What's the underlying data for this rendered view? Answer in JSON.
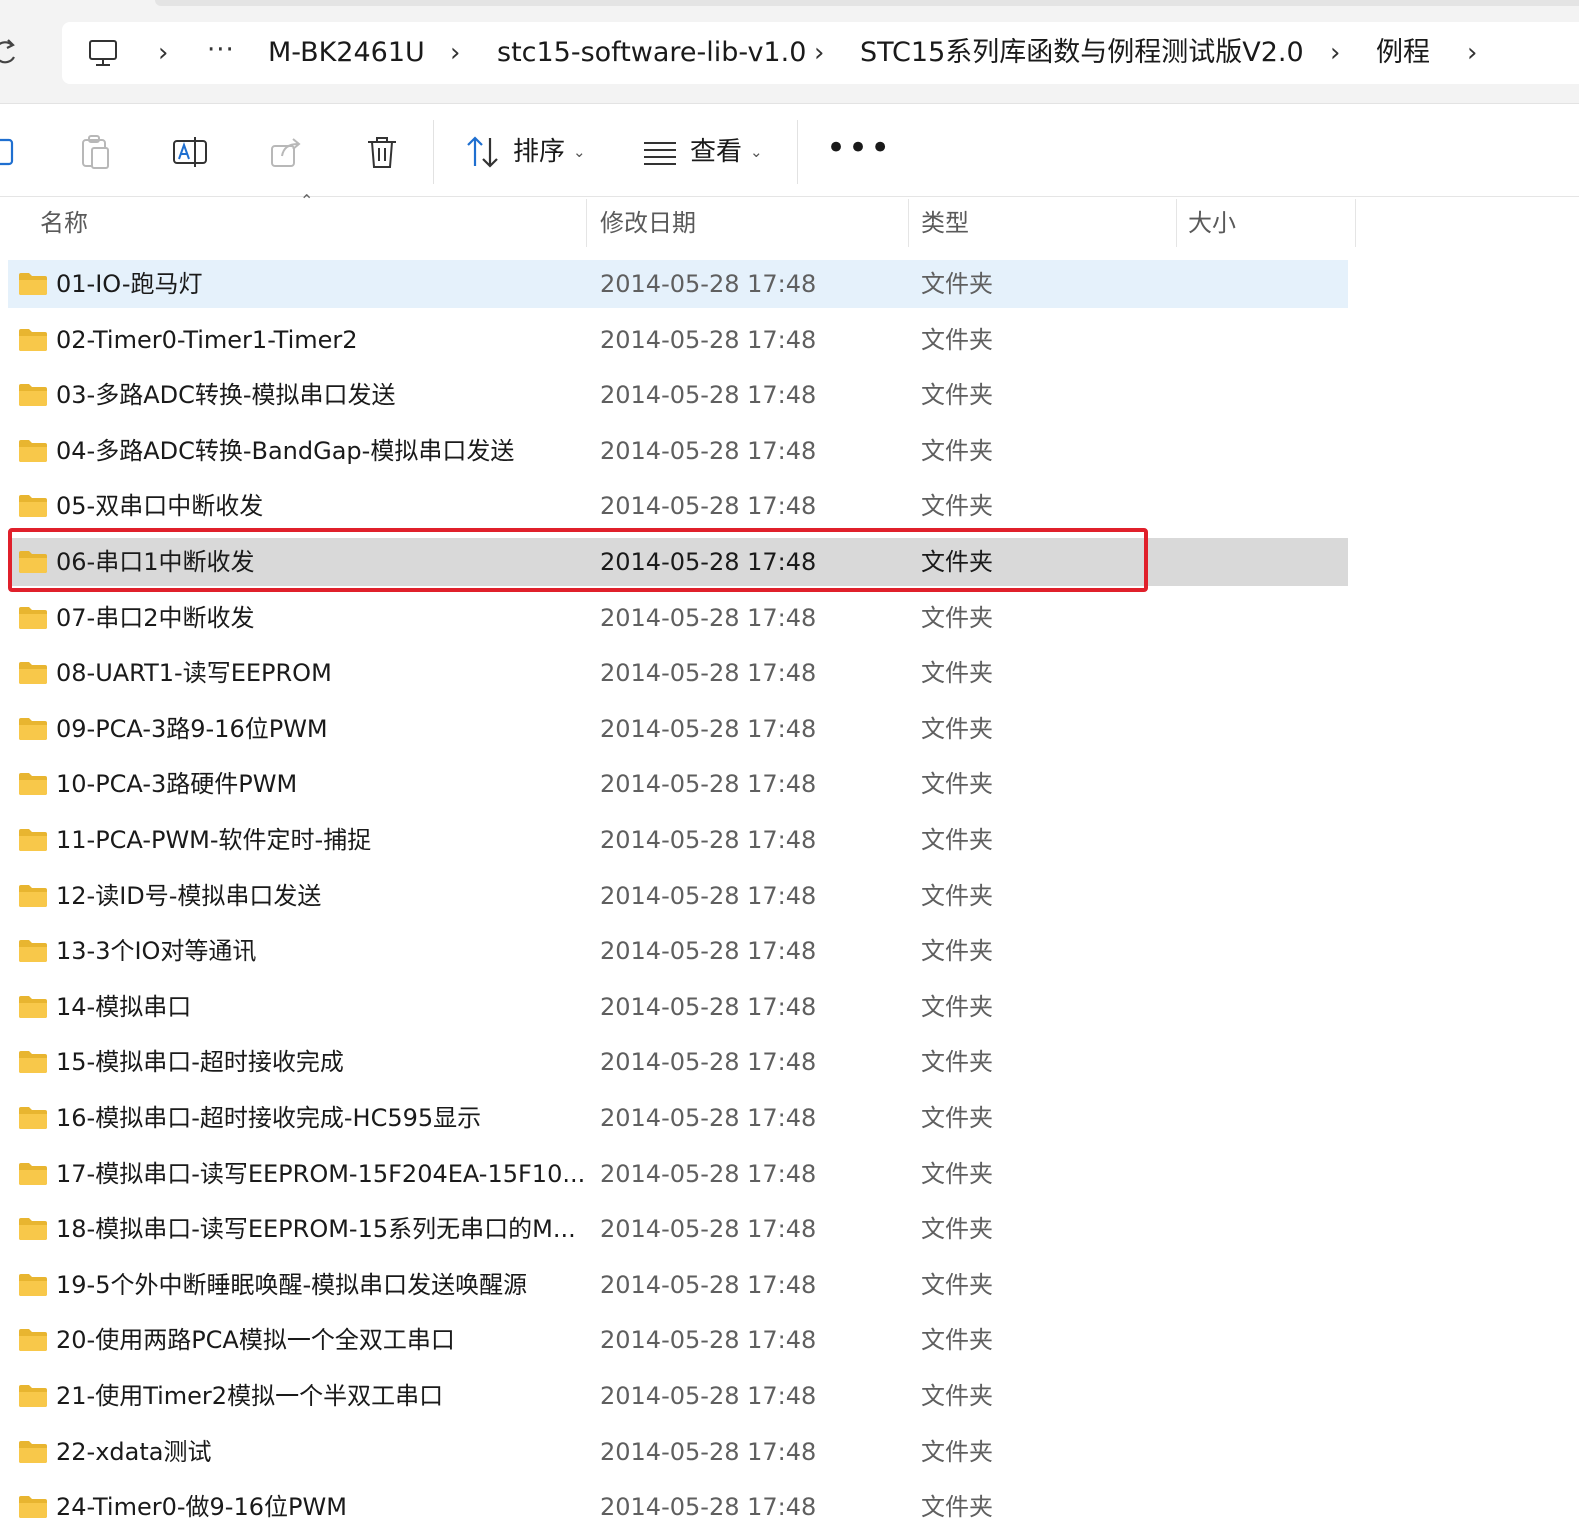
{
  "address_bar": {
    "breadcrumbs": [
      "M-BK2461U",
      "stc15-software-lib-v1.0",
      "STC15系列库函数与例程测试版V2.0",
      "例程"
    ],
    "overflow": "···"
  },
  "toolbar": {
    "sort_label": "排序",
    "view_label": "查看",
    "more_label": "•••"
  },
  "columns": {
    "name": "名称",
    "modified": "修改日期",
    "type": "类型",
    "size": "大小"
  },
  "files": [
    {
      "name": "01-IO-跑马灯",
      "modified": "2014-05-28 17:48",
      "type": "文件夹"
    },
    {
      "name": "02-Timer0-Timer1-Timer2",
      "modified": "2014-05-28 17:48",
      "type": "文件夹"
    },
    {
      "name": "03-多路ADC转换-模拟串口发送",
      "modified": "2014-05-28 17:48",
      "type": "文件夹"
    },
    {
      "name": "04-多路ADC转换-BandGap-模拟串口发送",
      "modified": "2014-05-28 17:48",
      "type": "文件夹"
    },
    {
      "name": "05-双串口中断收发",
      "modified": "2014-05-28 17:48",
      "type": "文件夹"
    },
    {
      "name": "06-串口1中断收发",
      "modified": "2014-05-28 17:48",
      "type": "文件夹"
    },
    {
      "name": "07-串口2中断收发",
      "modified": "2014-05-28 17:48",
      "type": "文件夹"
    },
    {
      "name": "08-UART1-读写EEPROM",
      "modified": "2014-05-28 17:48",
      "type": "文件夹"
    },
    {
      "name": "09-PCA-3路9-16位PWM",
      "modified": "2014-05-28 17:48",
      "type": "文件夹"
    },
    {
      "name": "10-PCA-3路硬件PWM",
      "modified": "2014-05-28 17:48",
      "type": "文件夹"
    },
    {
      "name": "11-PCA-PWM-软件定时-捕捉",
      "modified": "2014-05-28 17:48",
      "type": "文件夹"
    },
    {
      "name": "12-读ID号-模拟串口发送",
      "modified": "2014-05-28 17:48",
      "type": "文件夹"
    },
    {
      "name": "13-3个IO对等通讯",
      "modified": "2014-05-28 17:48",
      "type": "文件夹"
    },
    {
      "name": "14-模拟串口",
      "modified": "2014-05-28 17:48",
      "type": "文件夹"
    },
    {
      "name": "15-模拟串口-超时接收完成",
      "modified": "2014-05-28 17:48",
      "type": "文件夹"
    },
    {
      "name": "16-模拟串口-超时接收完成-HC595显示",
      "modified": "2014-05-28 17:48",
      "type": "文件夹"
    },
    {
      "name": "17-模拟串口-读写EEPROM-15F204EA-15F10...",
      "modified": "2014-05-28 17:48",
      "type": "文件夹"
    },
    {
      "name": "18-模拟串口-读写EEPROM-15系列无串口的M...",
      "modified": "2014-05-28 17:48",
      "type": "文件夹"
    },
    {
      "name": "19-5个外中断睡眠唤醒-模拟串口发送唤醒源",
      "modified": "2014-05-28 17:48",
      "type": "文件夹"
    },
    {
      "name": "20-使用两路PCA模拟一个全双工串口",
      "modified": "2014-05-28 17:48",
      "type": "文件夹"
    },
    {
      "name": "21-使用Timer2模拟一个半双工串口",
      "modified": "2014-05-28 17:48",
      "type": "文件夹"
    },
    {
      "name": "22-xdata测试",
      "modified": "2014-05-28 17:48",
      "type": "文件夹"
    },
    {
      "name": "24-Timer0-做9-16位PWM",
      "modified": "2014-05-28 17:48",
      "type": "文件夹"
    }
  ],
  "hover_index": 0,
  "selected_index": 5,
  "colors": {
    "hover": "#e5f1fb",
    "selected": "#d9d9d9",
    "highlight_box": "#e0202b",
    "folder": "#f8c84a"
  }
}
